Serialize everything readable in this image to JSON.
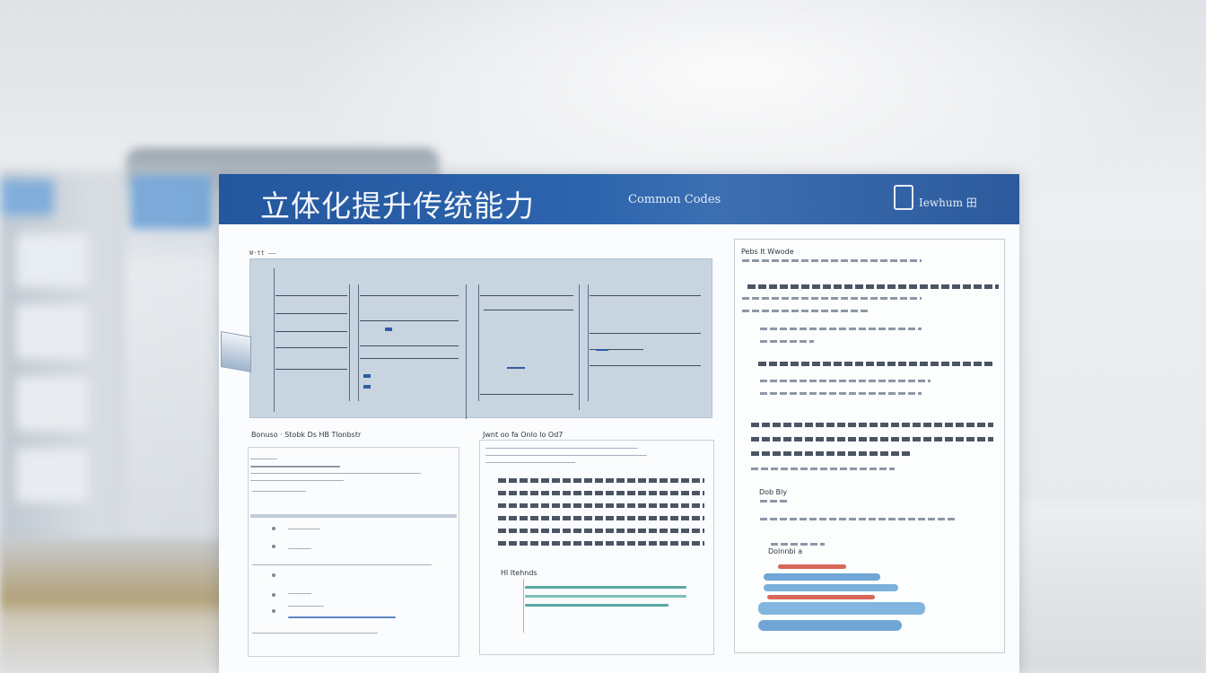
{
  "banner": {
    "title": "立体化提升传统能力",
    "subtitle": "Common Codes",
    "right_text": "Iewhum 田"
  },
  "shot": {
    "header": "W·tt  ——"
  },
  "sections": {
    "left_title": "Bonuso ·  Stobk  Ds  HB  Tlonbstr",
    "middle_title": "Jwnt  oo  fa  Onlo  lo  Od7",
    "middle_sub": "Hl  Itehnds",
    "right_title": "Pebs  It  Wwode",
    "right_subhead": "Dob  Bly",
    "right_subhead2": "Dolnnbi  a"
  },
  "colors": {
    "banner": "#2c64ad",
    "accent_teal": "#5aa8a4",
    "accent_blue": "#6fa6d6",
    "accent_red": "#d9665a"
  }
}
